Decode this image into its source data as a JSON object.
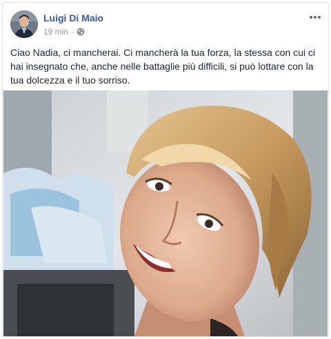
{
  "post": {
    "author": "Luigi Di Maio",
    "time": "19 min",
    "separator": "·",
    "privacy_icon": "globe-icon",
    "more_icon": "more-options-icon",
    "text": "Ciao Nadia, ci mancherai. Ci mancherà la tua forza, la stessa con cui ci hai insegnato che, anche nelle battaglie più difficili, si può lottare con la tua dolcezza e il tuo sorriso."
  },
  "colors": {
    "author": "#365899",
    "meta": "#90949c",
    "text": "#1d2129",
    "border": "#dddfe2"
  }
}
